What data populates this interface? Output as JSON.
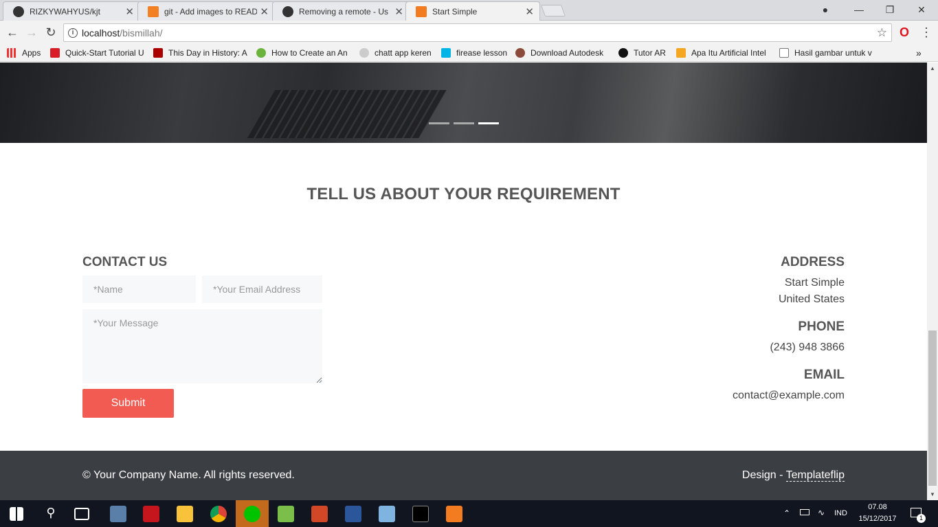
{
  "browser": {
    "tabs": [
      {
        "label": "RIZKYWAHYUS/kjt",
        "icon": "github-icon"
      },
      {
        "label": "git - Add images to READ",
        "icon": "stackoverflow-icon"
      },
      {
        "label": "Removing a remote - Us",
        "icon": "github-icon"
      },
      {
        "label": "Start Simple",
        "icon": "xampp-icon",
        "active": true
      }
    ],
    "url_host": "localhost",
    "url_path": "/bismillah/",
    "bookmarks": [
      "Apps",
      "Quick-Start Tutorial U",
      "This Day in History: A",
      "How to Create an An",
      "chatt app keren",
      "firease lesson",
      "Download Autodesk",
      "Tutor AR",
      "Apa Itu Artificial Intel",
      "Hasil gambar untuk v"
    ],
    "more_glyph": "»"
  },
  "page": {
    "requirement_title": "TELL US ABOUT YOUR REQUIREMENT",
    "contact": {
      "heading": "CONTACT US",
      "name_placeholder": "*Name",
      "email_placeholder": "*Your Email Address",
      "message_placeholder": "*Your Message",
      "submit_label": "Submit"
    },
    "info": {
      "address_heading": "ADDRESS",
      "address_line1": "Start Simple",
      "address_line2": "United States",
      "phone_heading": "PHONE",
      "phone": "(243) 948 3866",
      "email_heading": "EMAIL",
      "email": "contact@example.com"
    },
    "footer": {
      "copyright": "© Your Company Name. All rights reserved.",
      "design_prefix": "Design - ",
      "design_link": "Templateflip"
    }
  },
  "taskbar": {
    "lang": "IND",
    "time": "07.08",
    "date": "15/12/2017",
    "notification_count": "1"
  },
  "colors": {
    "accent": "#f25b51",
    "footer_bg": "#3b3e42",
    "heading": "#555555"
  }
}
